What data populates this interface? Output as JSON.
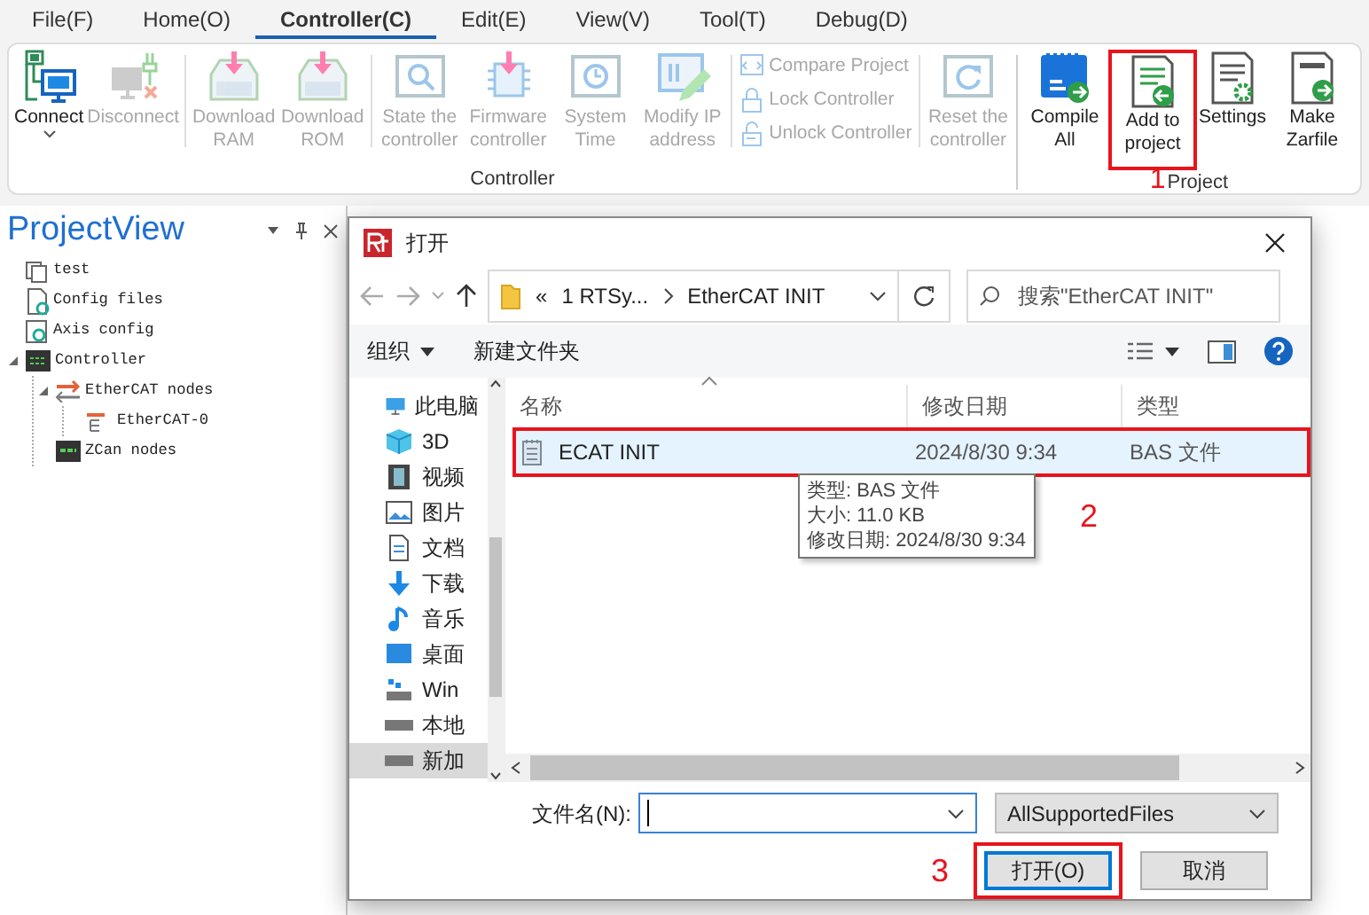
{
  "menu": [
    {
      "label": "File(F)",
      "selected": false
    },
    {
      "label": "Home(O)",
      "selected": false
    },
    {
      "label": "Controller(C)",
      "selected": true
    },
    {
      "label": "Edit(E)",
      "selected": false
    },
    {
      "label": "View(V)",
      "selected": false
    },
    {
      "label": "Tool(T)",
      "selected": false
    },
    {
      "label": "Debug(D)",
      "selected": false
    }
  ],
  "ribbon": {
    "groups": [
      {
        "label": "Controller",
        "items": [
          {
            "kind": "large",
            "label": "Connect",
            "disabled": false,
            "dropdown": true
          },
          {
            "kind": "large",
            "label": "Disconnect",
            "disabled": true
          },
          {
            "kind": "separator"
          },
          {
            "kind": "large",
            "label": "Download RAM",
            "disabled": true
          },
          {
            "kind": "large",
            "label": "Download ROM",
            "disabled": true
          },
          {
            "kind": "separator"
          },
          {
            "kind": "large",
            "label": "State the controller",
            "disabled": true
          },
          {
            "kind": "large",
            "label": "Firmware controller",
            "disabled": true
          },
          {
            "kind": "large",
            "label": "System Time",
            "disabled": true
          },
          {
            "kind": "large",
            "label": "Modify IP address",
            "disabled": true
          },
          {
            "kind": "separator"
          },
          {
            "kind": "stack",
            "items": [
              {
                "label": "Compare Project",
                "disabled": true
              },
              {
                "label": "Lock Controller",
                "disabled": true
              },
              {
                "label": "Unlock Controller",
                "disabled": true
              }
            ]
          },
          {
            "kind": "separator"
          },
          {
            "kind": "large",
            "label": "Reset the controller",
            "disabled": true
          }
        ]
      },
      {
        "label": "Project",
        "callout": "1",
        "items": [
          {
            "kind": "large",
            "label": "Compile All",
            "disabled": false,
            "highlighted": false
          },
          {
            "kind": "large",
            "label": "Add to project",
            "disabled": false,
            "highlighted": true
          },
          {
            "kind": "large",
            "label": "Settings",
            "disabled": false,
            "highlighted": false
          },
          {
            "kind": "large",
            "label": "Make Zarfile",
            "disabled": false,
            "highlighted": false
          }
        ]
      }
    ]
  },
  "project_view": {
    "title": "ProjectView",
    "tree": [
      {
        "label": "test"
      },
      {
        "label": "Config files"
      },
      {
        "label": "Axis config"
      },
      {
        "label": "Controller",
        "expanded": true,
        "children": [
          {
            "label": "EtherCAT nodes",
            "expanded": true,
            "children": [
              {
                "label": "EtherCAT-0"
              }
            ]
          },
          {
            "label": "ZCan nodes"
          }
        ]
      }
    ]
  },
  "dialog": {
    "title": "打开",
    "path": {
      "overflow": "«",
      "segments": [
        "1 RTSy...",
        "EtherCAT INIT"
      ]
    },
    "search": {
      "placeholder": "搜索\"EtherCAT INIT\""
    },
    "toolbar": {
      "organize": "组织",
      "new_folder": "新建文件夹"
    },
    "nav": [
      {
        "label": "此电脑",
        "selected": false
      },
      {
        "label": "3D",
        "selected": false
      },
      {
        "label": "视频",
        "selected": false
      },
      {
        "label": "图片",
        "selected": false
      },
      {
        "label": "文档",
        "selected": false
      },
      {
        "label": "下载",
        "selected": false
      },
      {
        "label": "音乐",
        "selected": false
      },
      {
        "label": "桌面",
        "selected": false
      },
      {
        "label": "Win",
        "selected": false
      },
      {
        "label": "本地",
        "selected": false
      },
      {
        "label": "新加",
        "selected": true
      }
    ],
    "columns": [
      "名称",
      "修改日期",
      "类型"
    ],
    "files": [
      {
        "name": "ECAT INIT",
        "modified": "2024/8/30 9:34",
        "type": "BAS 文件",
        "selected": true,
        "highlighted": true,
        "callout": "2"
      }
    ],
    "tooltip": [
      "类型: BAS 文件",
      "大小: 11.0 KB",
      "修改日期: 2024/8/30 9:34"
    ],
    "filename": {
      "label": "文件名(N):"
    },
    "filter": "AllSupportedFiles",
    "buttons": [
      {
        "label": "打开(O)",
        "default": true,
        "highlighted": true,
        "callout": "3"
      },
      {
        "label": "取消",
        "default": false,
        "highlighted": false
      }
    ]
  }
}
